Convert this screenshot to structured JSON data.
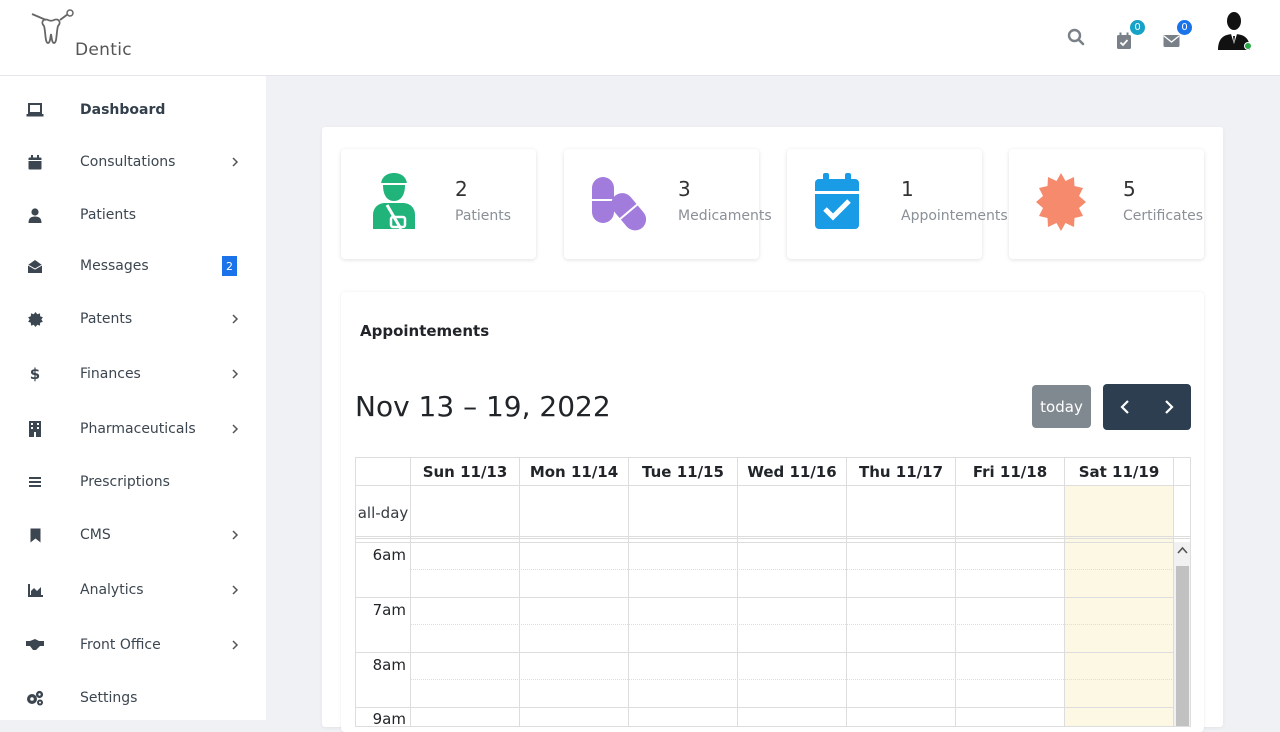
{
  "brand": {
    "name": "Dentic"
  },
  "topbar": {
    "tasks_badge": "0",
    "mail_badge": "0"
  },
  "colors": {
    "badge": "#17a2c8",
    "messages_badge": "#1a73e8",
    "patients": "#20b37a",
    "medicaments": "#a27cdc",
    "appointments": "#1a9be6",
    "certificates": "#f58a6c",
    "nav_dark": "#2c3e50"
  },
  "sidebar": {
    "items": [
      {
        "label": "Dashboard",
        "icon": "laptop-icon"
      },
      {
        "label": "Consultations",
        "icon": "calendar-icon"
      },
      {
        "label": "Patients",
        "icon": "user-icon"
      },
      {
        "label": "Messages",
        "icon": "envelope-open-icon",
        "badge": "2"
      },
      {
        "label": "Patents",
        "icon": "certificate-icon"
      },
      {
        "label": "Finances",
        "icon": "dollar-icon"
      },
      {
        "label": "Pharmaceuticals",
        "icon": "building-icon"
      },
      {
        "label": "Prescriptions",
        "icon": "list-icon"
      },
      {
        "label": "CMS",
        "icon": "bookmark-icon"
      },
      {
        "label": "Analytics",
        "icon": "chart-area-icon"
      },
      {
        "label": "Front Office",
        "icon": "handshake-icon"
      },
      {
        "label": "Settings",
        "icon": "cogs-icon"
      }
    ]
  },
  "stats": [
    {
      "value": "2",
      "label": "Patients",
      "icon": "user-injured-icon"
    },
    {
      "value": "3",
      "label": "Medicaments",
      "icon": "pills-icon"
    },
    {
      "value": "1",
      "label": "Appointements",
      "icon": "calendar-check-icon"
    },
    {
      "value": "5",
      "label": "Certificates",
      "icon": "certificate-icon"
    }
  ],
  "calendar": {
    "heading": "Appointements",
    "range": "Nov 13 – 19, 2022",
    "today_label": "today",
    "days": [
      "Sun 11/13",
      "Mon 11/14",
      "Tue 11/15",
      "Wed 11/16",
      "Thu 11/17",
      "Fri 11/18",
      "Sat 11/19"
    ],
    "allday_label": "all-day",
    "times": [
      "6am",
      "7am",
      "8am",
      "9am"
    ]
  }
}
